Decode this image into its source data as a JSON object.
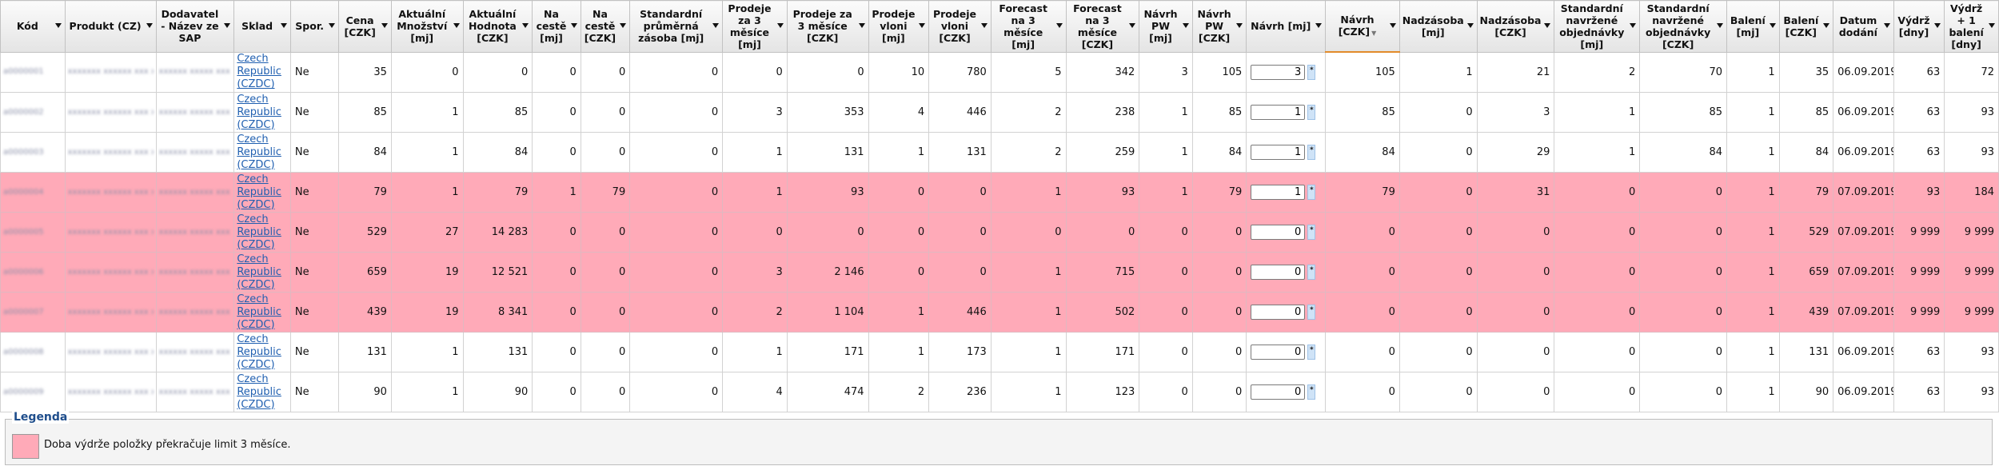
{
  "columns": [
    {
      "label": "Kód"
    },
    {
      "label": "Produkt (CZ)"
    },
    {
      "label": "Dodavatel - Název ze SAP"
    },
    {
      "label": "Sklad"
    },
    {
      "label": "Spor."
    },
    {
      "label": "Cena [CZK]"
    },
    {
      "label": "Aktuální Množství [mj]"
    },
    {
      "label": "Aktuální Hodnota [CZK]"
    },
    {
      "label": "Na cestě [mj]"
    },
    {
      "label": "Na cestě [CZK]"
    },
    {
      "label": "Standardní průměrná zásoba [mj]"
    },
    {
      "label": "Prodeje za 3 měsíce [mj]"
    },
    {
      "label": "Prodeje za 3 měsíce [CZK]"
    },
    {
      "label": "Prodeje vloni [mj]"
    },
    {
      "label": "Prodeje vloni [CZK]"
    },
    {
      "label": "Forecast na 3 měsíce [mj]"
    },
    {
      "label": "Forecast na 3 měsíce [CZK]"
    },
    {
      "label": "Návrh PW [mj]"
    },
    {
      "label": "Návrh PW [CZK]"
    },
    {
      "label": "Návrh [mj]"
    },
    {
      "label": "Návrh [CZK]"
    },
    {
      "label": "Nadzásoba [mj]"
    },
    {
      "label": "Nadzásoba [CZK]"
    },
    {
      "label": "Standardní navržené objednávky [mj]"
    },
    {
      "label": "Standardní navržené objednávky [CZK]"
    },
    {
      "label": "Balení [mj]"
    },
    {
      "label": "Balení [CZK]"
    },
    {
      "label": "Datum dodání"
    },
    {
      "label": "Výdrž [dny]"
    },
    {
      "label": "Výdrž + 1 balení [dny]"
    }
  ],
  "sorted_column": "Návrh [CZK]",
  "rows": [
    {
      "warn": false,
      "kod": "a0000001",
      "produkt": "xxxxxxx xxxxxx xxx xxxxx",
      "dodavatel": "xxxxxx xxxxx xxx",
      "sklad": "Czech Republic (CZDC)",
      "spor": "Ne",
      "cena": "35",
      "akt_mnozstvi": "0",
      "akt_hodnota": "0",
      "na_ceste_mj": "0",
      "na_ceste_czk": "0",
      "std_zasoba": "0",
      "prodeje3_mj": "0",
      "prodeje3_czk": "0",
      "vloni_mj": "10",
      "vloni_czk": "780",
      "forecast_mj": "5",
      "forecast_czk": "342",
      "pw_mj": "3",
      "pw_czk": "105",
      "navrh_mj": "3",
      "navrh_czk": "105",
      "nadz_mj": "1",
      "nadz_czk": "21",
      "std_obj_mj": "2",
      "std_obj_czk": "70",
      "baleni_mj": "1",
      "baleni_czk": "35",
      "datum": "06.09.2019",
      "vydrz": "63",
      "vydrz_bal": "72"
    },
    {
      "warn": false,
      "kod": "a0000002",
      "produkt": "xxxxxxx xxxxxx xxx xxxxx",
      "dodavatel": "xxxxxx xxxxx xxx",
      "sklad": "Czech Republic (CZDC)",
      "spor": "Ne",
      "cena": "85",
      "akt_mnozstvi": "1",
      "akt_hodnota": "85",
      "na_ceste_mj": "0",
      "na_ceste_czk": "0",
      "std_zasoba": "0",
      "prodeje3_mj": "3",
      "prodeje3_czk": "353",
      "vloni_mj": "4",
      "vloni_czk": "446",
      "forecast_mj": "2",
      "forecast_czk": "238",
      "pw_mj": "1",
      "pw_czk": "85",
      "navrh_mj": "1",
      "navrh_czk": "85",
      "nadz_mj": "0",
      "nadz_czk": "3",
      "std_obj_mj": "1",
      "std_obj_czk": "85",
      "baleni_mj": "1",
      "baleni_czk": "85",
      "datum": "06.09.2019",
      "vydrz": "63",
      "vydrz_bal": "93"
    },
    {
      "warn": false,
      "kod": "a0000003",
      "produkt": "xxxxxxx xxxxxx xxx xxxxx",
      "dodavatel": "xxxxxx xxxxx xxx",
      "sklad": "Czech Republic (CZDC)",
      "spor": "Ne",
      "cena": "84",
      "akt_mnozstvi": "1",
      "akt_hodnota": "84",
      "na_ceste_mj": "0",
      "na_ceste_czk": "0",
      "std_zasoba": "0",
      "prodeje3_mj": "1",
      "prodeje3_czk": "131",
      "vloni_mj": "1",
      "vloni_czk": "131",
      "forecast_mj": "2",
      "forecast_czk": "259",
      "pw_mj": "1",
      "pw_czk": "84",
      "navrh_mj": "1",
      "navrh_czk": "84",
      "nadz_mj": "0",
      "nadz_czk": "29",
      "std_obj_mj": "1",
      "std_obj_czk": "84",
      "baleni_mj": "1",
      "baleni_czk": "84",
      "datum": "06.09.2019",
      "vydrz": "63",
      "vydrz_bal": "93"
    },
    {
      "warn": true,
      "kod": "a0000004",
      "produkt": "xxxxxxx xxxxxx xxx xxxxx",
      "dodavatel": "xxxxxx xxxxx xxx",
      "sklad": "Czech Republic (CZDC)",
      "spor": "Ne",
      "cena": "79",
      "akt_mnozstvi": "1",
      "akt_hodnota": "79",
      "na_ceste_mj": "1",
      "na_ceste_czk": "79",
      "std_zasoba": "0",
      "prodeje3_mj": "1",
      "prodeje3_czk": "93",
      "vloni_mj": "0",
      "vloni_czk": "0",
      "forecast_mj": "1",
      "forecast_czk": "93",
      "pw_mj": "1",
      "pw_czk": "79",
      "navrh_mj": "1",
      "navrh_czk": "79",
      "nadz_mj": "0",
      "nadz_czk": "31",
      "std_obj_mj": "0",
      "std_obj_czk": "0",
      "baleni_mj": "1",
      "baleni_czk": "79",
      "datum": "07.09.2019",
      "vydrz": "93",
      "vydrz_bal": "184"
    },
    {
      "warn": true,
      "kod": "a0000005",
      "produkt": "xxxxxxx xxxxxx xxx xxxxx",
      "dodavatel": "xxxxxx xxxxx xxx",
      "sklad": "Czech Republic (CZDC)",
      "spor": "Ne",
      "cena": "529",
      "akt_mnozstvi": "27",
      "akt_hodnota": "14 283",
      "na_ceste_mj": "0",
      "na_ceste_czk": "0",
      "std_zasoba": "0",
      "prodeje3_mj": "0",
      "prodeje3_czk": "0",
      "vloni_mj": "0",
      "vloni_czk": "0",
      "forecast_mj": "0",
      "forecast_czk": "0",
      "pw_mj": "0",
      "pw_czk": "0",
      "navrh_mj": "0",
      "navrh_czk": "0",
      "nadz_mj": "0",
      "nadz_czk": "0",
      "std_obj_mj": "0",
      "std_obj_czk": "0",
      "baleni_mj": "1",
      "baleni_czk": "529",
      "datum": "07.09.2019",
      "vydrz": "9 999",
      "vydrz_bal": "9 999"
    },
    {
      "warn": true,
      "kod": "a0000006",
      "produkt": "xxxxxxx xxxxxx xxx xxxxx",
      "dodavatel": "xxxxxx xxxxx xxx",
      "sklad": "Czech Republic (CZDC)",
      "spor": "Ne",
      "cena": "659",
      "akt_mnozstvi": "19",
      "akt_hodnota": "12 521",
      "na_ceste_mj": "0",
      "na_ceste_czk": "0",
      "std_zasoba": "0",
      "prodeje3_mj": "3",
      "prodeje3_czk": "2 146",
      "vloni_mj": "0",
      "vloni_czk": "0",
      "forecast_mj": "1",
      "forecast_czk": "715",
      "pw_mj": "0",
      "pw_czk": "0",
      "navrh_mj": "0",
      "navrh_czk": "0",
      "nadz_mj": "0",
      "nadz_czk": "0",
      "std_obj_mj": "0",
      "std_obj_czk": "0",
      "baleni_mj": "1",
      "baleni_czk": "659",
      "datum": "07.09.2019",
      "vydrz": "9 999",
      "vydrz_bal": "9 999"
    },
    {
      "warn": true,
      "kod": "a0000007",
      "produkt": "xxxxxxx xxxxxx xxx xxxxx",
      "dodavatel": "xxxxxx xxxxx xxx",
      "sklad": "Czech Republic (CZDC)",
      "spor": "Ne",
      "cena": "439",
      "akt_mnozstvi": "19",
      "akt_hodnota": "8 341",
      "na_ceste_mj": "0",
      "na_ceste_czk": "0",
      "std_zasoba": "0",
      "prodeje3_mj": "2",
      "prodeje3_czk": "1 104",
      "vloni_mj": "1",
      "vloni_czk": "446",
      "forecast_mj": "1",
      "forecast_czk": "502",
      "pw_mj": "0",
      "pw_czk": "0",
      "navrh_mj": "0",
      "navrh_czk": "0",
      "nadz_mj": "0",
      "nadz_czk": "0",
      "std_obj_mj": "0",
      "std_obj_czk": "0",
      "baleni_mj": "1",
      "baleni_czk": "439",
      "datum": "07.09.2019",
      "vydrz": "9 999",
      "vydrz_bal": "9 999"
    },
    {
      "warn": false,
      "kod": "a0000008",
      "produkt": "xxxxxxx xxxxxx xxx xxxxx",
      "dodavatel": "xxxxxx xxxxx xxx",
      "sklad": "Czech Republic (CZDC)",
      "spor": "Ne",
      "cena": "131",
      "akt_mnozstvi": "1",
      "akt_hodnota": "131",
      "na_ceste_mj": "0",
      "na_ceste_czk": "0",
      "std_zasoba": "0",
      "prodeje3_mj": "1",
      "prodeje3_czk": "171",
      "vloni_mj": "1",
      "vloni_czk": "173",
      "forecast_mj": "1",
      "forecast_czk": "171",
      "pw_mj": "0",
      "pw_czk": "0",
      "navrh_mj": "0",
      "navrh_czk": "0",
      "nadz_mj": "0",
      "nadz_czk": "0",
      "std_obj_mj": "0",
      "std_obj_czk": "0",
      "baleni_mj": "1",
      "baleni_czk": "131",
      "datum": "06.09.2019",
      "vydrz": "63",
      "vydrz_bal": "93"
    },
    {
      "warn": false,
      "kod": "a0000009",
      "produkt": "xxxxxxx xxxxxx xxx xxxxx",
      "dodavatel": "xxxxxx xxxxx xxx",
      "sklad": "Czech Republic (CZDC)",
      "spor": "Ne",
      "cena": "90",
      "akt_mnozstvi": "1",
      "akt_hodnota": "90",
      "na_ceste_mj": "0",
      "na_ceste_czk": "0",
      "std_zasoba": "0",
      "prodeje3_mj": "4",
      "prodeje3_czk": "474",
      "vloni_mj": "2",
      "vloni_czk": "236",
      "forecast_mj": "1",
      "forecast_czk": "123",
      "pw_mj": "0",
      "pw_czk": "0",
      "navrh_mj": "0",
      "navrh_czk": "0",
      "nadz_mj": "0",
      "nadz_czk": "0",
      "std_obj_mj": "0",
      "std_obj_czk": "0",
      "baleni_mj": "1",
      "baleni_czk": "90",
      "datum": "06.09.2019",
      "vydrz": "63",
      "vydrz_bal": "93"
    }
  ],
  "legend": {
    "title": "Legenda",
    "swatch_color": "#ffaab8",
    "text": "Doba výdrže položky překračuje limit 3 měsíce."
  },
  "icons": {
    "column_menu": "caret-down-icon",
    "input_spin": "star-spin-icon"
  }
}
